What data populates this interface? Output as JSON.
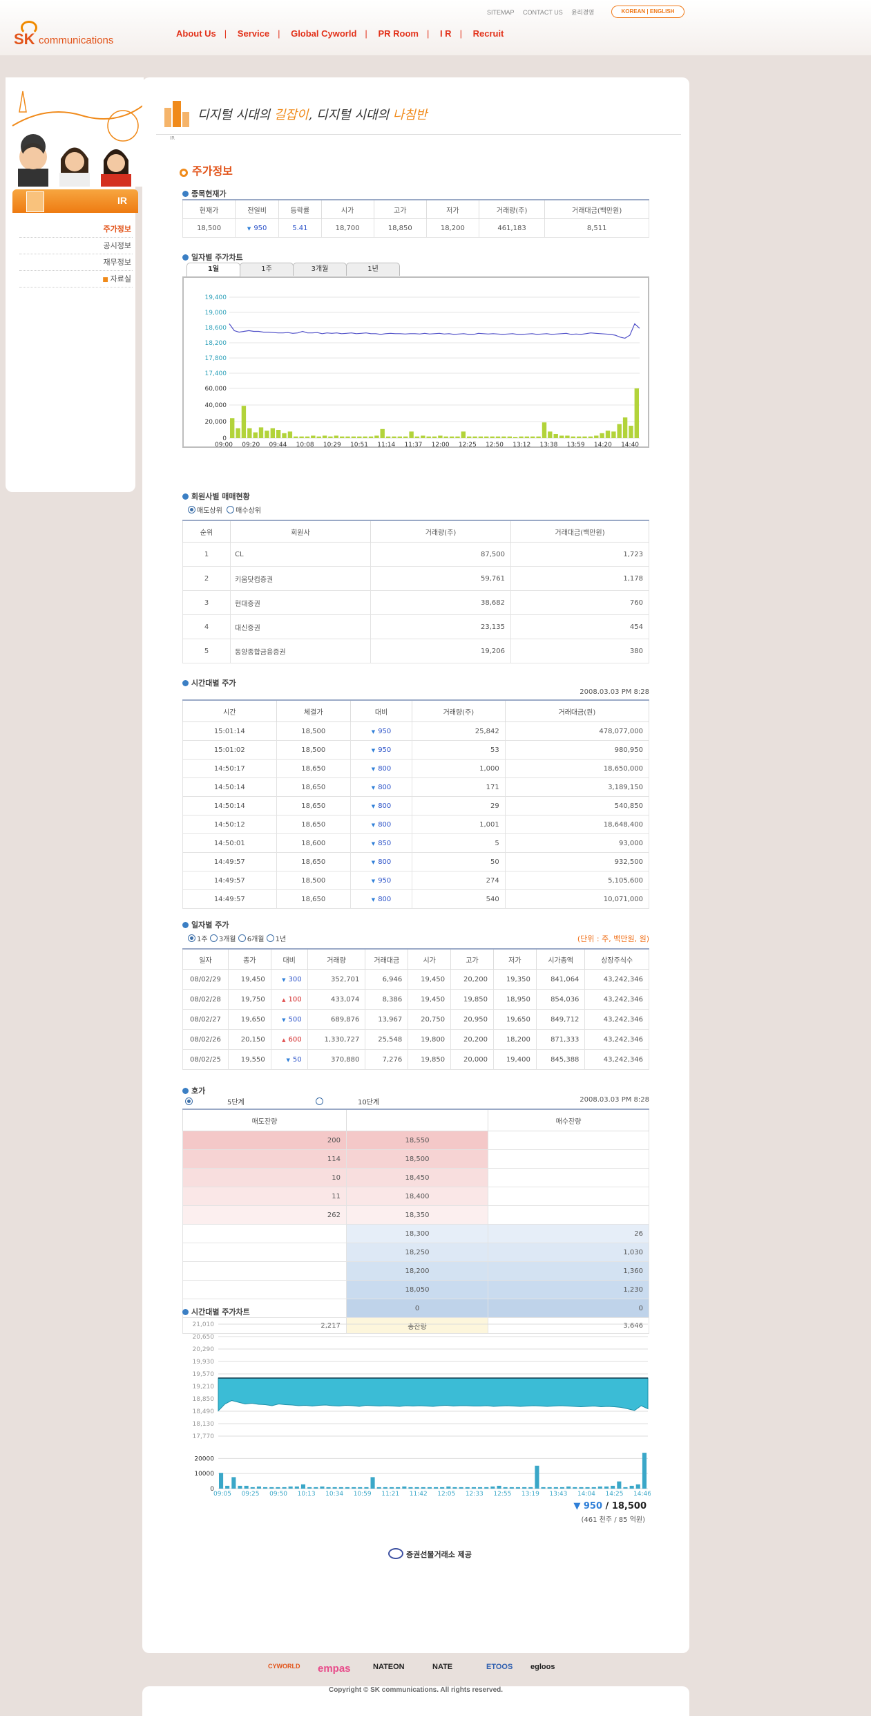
{
  "header": {
    "logo_sk": "SK",
    "logo_comm": "communications",
    "util": [
      "SITEMAP",
      "CONTACT US",
      "윤리경영"
    ],
    "lang": "KOREAN | ENGLISH",
    "gnb": [
      "About Us",
      "Service",
      "Global Cyworld",
      "PR Room",
      "I R",
      "Recruit"
    ]
  },
  "sidebar": {
    "tab": "IR",
    "items": [
      "주가정보",
      "공시정보",
      "재무정보",
      "자료실"
    ]
  },
  "banner": {
    "slogan_a": "디지털 시대의 ",
    "slogan_b": "길잡이",
    "slogan_c": ", 디지털 시대의 ",
    "slogan_d": "나침반",
    "crumb": "IR"
  },
  "page_title": "주가정보",
  "current": {
    "title": "종목현재가",
    "headers": [
      "현재가",
      "전일비",
      "등락률",
      "시가",
      "고가",
      "저가",
      "거래량(주)",
      "거래대금(백만원)"
    ],
    "values": [
      "18,500",
      "950",
      "5.41",
      "18,700",
      "18,850",
      "18,200",
      "461,183",
      "8,511"
    ]
  },
  "daily_chart": {
    "title": "일자별 주가차트",
    "tabs": [
      "1일",
      "1주",
      "3개월",
      "1년"
    ]
  },
  "chart_data": [
    {
      "type": "line",
      "title": "",
      "ylim": [
        17400,
        19400
      ],
      "yticks": [
        "19,400",
        "19,000",
        "18,600",
        "18,200",
        "17,800",
        "17,400"
      ],
      "x": [
        "09:00",
        "09:20",
        "09:44",
        "10:08",
        "10:29",
        "10:51",
        "11:14",
        "11:37",
        "12:00",
        "12:25",
        "12:50",
        "13:12",
        "13:38",
        "13:59",
        "14:20",
        "14:40"
      ],
      "values": [
        18700,
        18520,
        18480,
        18500,
        18520,
        18500,
        18500,
        18480,
        18480,
        18470,
        18460,
        18460,
        18470,
        18450,
        18460,
        18500,
        18460,
        18460,
        18470,
        18440,
        18460,
        18450,
        18460,
        18440,
        18450,
        18460,
        18440,
        18450,
        18460,
        18440,
        18440,
        18420,
        18440,
        18450,
        18440,
        18440,
        18430,
        18440,
        18440,
        18430,
        18450,
        18430,
        18440,
        18450,
        18430,
        18440,
        18420,
        18430,
        18440,
        18420,
        18420,
        18450,
        18440,
        18430,
        18440,
        18430,
        18420,
        18430,
        18440,
        18420,
        18420,
        18430,
        18440,
        18420,
        18430,
        18440,
        18420,
        18430,
        18440,
        18450,
        18420,
        18430,
        18420,
        18440,
        18460,
        18450,
        18440,
        18430,
        18420,
        18400,
        18350,
        18320,
        18400,
        18700,
        18580
      ]
    },
    {
      "type": "bar",
      "title": "",
      "ylim": [
        0,
        60000
      ],
      "yticks": [
        "60,000",
        "40,000",
        "20,000",
        "0"
      ],
      "values": [
        24000,
        12000,
        39000,
        12000,
        7000,
        13000,
        9000,
        12000,
        10000,
        6000,
        8000,
        2000,
        2000,
        2000,
        3000,
        2000,
        3000,
        2000,
        3000,
        2000,
        2000,
        2000,
        2000,
        2000,
        2000,
        3000,
        11000,
        2000,
        2000,
        2000,
        2000,
        8000,
        2000,
        3000,
        2000,
        2000,
        3000,
        2000,
        2000,
        2000,
        8000,
        2000,
        2000,
        2000,
        2000,
        2000,
        2000,
        2000,
        2000,
        1500,
        2000,
        2000,
        2000,
        2000,
        19000,
        8000,
        5000,
        3000,
        3000,
        2000,
        2000,
        2000,
        2000,
        3000,
        6000,
        9000,
        8000,
        17000,
        25000,
        15000,
        60000
      ]
    },
    {
      "type": "area",
      "title": "",
      "yticks": [
        "21,010",
        "20,650",
        "20,290",
        "19,930",
        "19,570",
        "19,210",
        "18,850",
        "18,490",
        "18,130",
        "17,770"
      ],
      "ylim": [
        17770,
        21010
      ],
      "x": [
        "09:05",
        "09:25",
        "09:50",
        "10:13",
        "10:34",
        "10:59",
        "11:21",
        "11:42",
        "12:05",
        "12:33",
        "12:55",
        "13:19",
        "13:43",
        "14:04",
        "14:25",
        "14:46"
      ],
      "reference": 19450,
      "values": [
        18500,
        18700,
        18800,
        18750,
        18700,
        18720,
        18690,
        18680,
        18650,
        18700,
        18680,
        18670,
        18650,
        18660,
        18640,
        18660,
        18670,
        18650,
        18640,
        18660,
        18650,
        18630,
        18660,
        18650,
        18640,
        18650,
        18640,
        18630,
        18650,
        18640,
        18650,
        18640,
        18630,
        18650,
        18660,
        18640,
        18650,
        18650,
        18640,
        18640,
        18650,
        18630,
        18640,
        18650,
        18640,
        18630,
        18640,
        18650,
        18640,
        18630,
        18640,
        18650,
        18640,
        18630,
        18620,
        18630,
        18640,
        18620,
        18630,
        18620,
        18600,
        18560,
        18510,
        18650,
        18560
      ]
    },
    {
      "type": "bar",
      "title": "",
      "yticks": [
        "20000",
        "10000",
        "0"
      ],
      "ylim": [
        0,
        27000
      ],
      "values": [
        11000,
        2000,
        8000,
        2000,
        2000,
        1000,
        1500,
        1000,
        1000,
        1000,
        1000,
        1500,
        1500,
        3000,
        1000,
        1000,
        1500,
        1000,
        1000,
        1000,
        1000,
        1000,
        1000,
        1000,
        8000,
        1000,
        1000,
        1000,
        1000,
        1500,
        1000,
        1000,
        1000,
        1000,
        1000,
        1000,
        1500,
        1000,
        1000,
        1000,
        1000,
        1000,
        1000,
        1500,
        2000,
        1000,
        1000,
        1000,
        1000,
        1000,
        16000,
        1000,
        1000,
        1000,
        1000,
        1500,
        1000,
        1000,
        1000,
        1000,
        1500,
        1500,
        2000,
        5000,
        1000,
        2000,
        3000,
        25000
      ]
    }
  ],
  "members": {
    "title": "회원사별 매매현황",
    "radios": [
      "매도상위",
      "매수상위"
    ],
    "headers": [
      "순위",
      "회원사",
      "거래량(주)",
      "거래대금(백만원)"
    ],
    "rows": [
      [
        "1",
        "CL",
        "87,500",
        "1,723"
      ],
      [
        "2",
        "키움닷컴증권",
        "59,761",
        "1,178"
      ],
      [
        "3",
        "현대증권",
        "38,682",
        "760"
      ],
      [
        "4",
        "대신증권",
        "23,135",
        "454"
      ],
      [
        "5",
        "동양종합금융증권",
        "19,206",
        "380"
      ]
    ]
  },
  "timely": {
    "title": "시간대별 주가",
    "date": "2008.03.03 PM 8:28",
    "headers": [
      "시간",
      "체결가",
      "대비",
      "거래량(주)",
      "거래대금(원)"
    ],
    "rows": [
      [
        "15:01:14",
        "18,500",
        "950",
        "25,842",
        "478,077,000"
      ],
      [
        "15:01:02",
        "18,500",
        "950",
        "53",
        "980,950"
      ],
      [
        "14:50:17",
        "18,650",
        "800",
        "1,000",
        "18,650,000"
      ],
      [
        "14:50:14",
        "18,650",
        "800",
        "171",
        "3,189,150"
      ],
      [
        "14:50:14",
        "18,650",
        "800",
        "29",
        "540,850"
      ],
      [
        "14:50:12",
        "18,650",
        "800",
        "1,001",
        "18,648,400"
      ],
      [
        "14:50:01",
        "18,600",
        "850",
        "5",
        "93,000"
      ],
      [
        "14:49:57",
        "18,650",
        "800",
        "50",
        "932,500"
      ],
      [
        "14:49:57",
        "18,500",
        "950",
        "274",
        "5,105,600"
      ],
      [
        "14:49:57",
        "18,650",
        "800",
        "540",
        "10,071,000"
      ]
    ]
  },
  "daily": {
    "title": "일자별 주가",
    "radios": [
      "1주",
      "3개월",
      "6개월",
      "1년"
    ],
    "unit": "(단위 : 주, 백만원, 원)",
    "headers": [
      "일자",
      "종가",
      "대비",
      "거래량",
      "거래대금",
      "시가",
      "고가",
      "저가",
      "시가총액",
      "상장주식수"
    ],
    "rows": [
      [
        "08/02/29",
        "19,450",
        "300",
        "352,701",
        "6,946",
        "19,450",
        "20,200",
        "19,350",
        "841,064",
        "43,242,346"
      ],
      [
        "08/02/28",
        "19,750",
        "100",
        "433,074",
        "8,386",
        "19,450",
        "19,850",
        "18,950",
        "854,036",
        "43,242,346"
      ],
      [
        "08/02/27",
        "19,650",
        "500",
        "689,876",
        "13,967",
        "20,750",
        "20,950",
        "19,650",
        "849,712",
        "43,242,346"
      ],
      [
        "08/02/26",
        "20,150",
        "600",
        "1,330,727",
        "25,548",
        "19,800",
        "20,200",
        "18,200",
        "871,333",
        "43,242,346"
      ],
      [
        "08/02/25",
        "19,550",
        "50",
        "370,880",
        "7,276",
        "19,850",
        "20,000",
        "19,400",
        "845,388",
        "43,242,346"
      ]
    ],
    "dirs": [
      "dn",
      "up",
      "dn",
      "up",
      "dn"
    ]
  },
  "hoga": {
    "title": "호가",
    "radios": [
      "5단계",
      "10단계"
    ],
    "date": "2008.03.03 PM 8:28",
    "headers": [
      "매도잔량",
      "",
      "매수잔량"
    ],
    "sell": [
      [
        "200",
        "18,550"
      ],
      [
        "114",
        "18,500"
      ],
      [
        "10",
        "18,450"
      ],
      [
        "11",
        "18,400"
      ],
      [
        "262",
        "18,350"
      ]
    ],
    "buy": [
      [
        "18,300",
        "26"
      ],
      [
        "18,250",
        "1,030"
      ],
      [
        "18,200",
        "1,360"
      ],
      [
        "18,050",
        "1,230"
      ],
      [
        "0",
        "0"
      ]
    ],
    "total": [
      "2,217",
      "총잔량",
      "3,646"
    ]
  },
  "intraday": {
    "title": "시간대별 주가차트",
    "change": "950",
    "sep": "/",
    "price": "18,500",
    "volume": "(461 천주 / 85 억원)"
  },
  "provider": "증권선물거래소 제공",
  "footer": {
    "logos": [
      "CYWORLD",
      "empas",
      "NATEON",
      "NATE",
      "ETOOS",
      "egloos"
    ],
    "copyright": "Copyright © SK communications. All rights reserved."
  }
}
